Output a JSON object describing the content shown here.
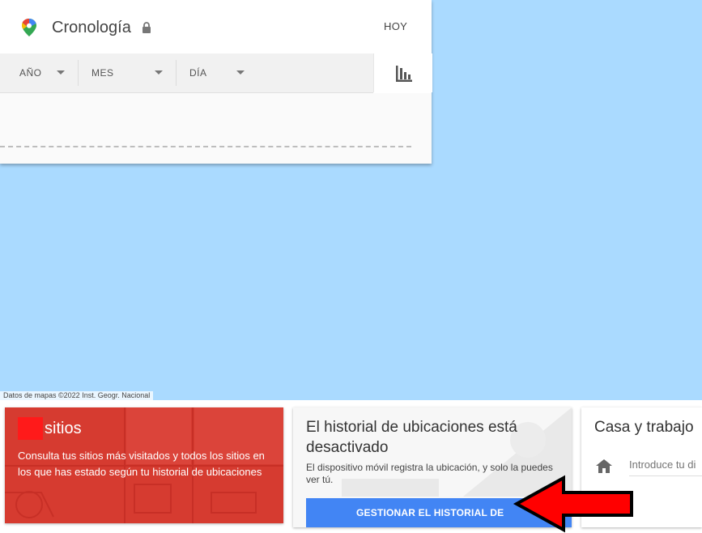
{
  "map": {
    "attribution": "Datos de mapas ©2022 Inst. Geogr. Nacional",
    "water_color": "#aadaff"
  },
  "timeline": {
    "title": "Cronología",
    "today_label": "HOY",
    "icons": {
      "logo": "maps-pin-icon",
      "lock": "lock-icon",
      "chart": "bar-chart-icon"
    },
    "dropdowns": [
      {
        "label": "AÑO"
      },
      {
        "label": "MES"
      },
      {
        "label": "DÍA"
      }
    ]
  },
  "cards": {
    "places": {
      "title": "sitios",
      "description": "Consulta tus sitios más visitados y todos los sitios en los que has estado según tu historial de ubicaciones",
      "color": "#d63b30"
    },
    "history": {
      "title": "El historial de ubicaciones está desactivado",
      "description": "El dispositivo móvil registra la ubicación, y solo la puedes ver tú.",
      "button_label": "GESTIONAR EL HISTORIAL DE",
      "button_color": "#4285f4"
    },
    "home_work": {
      "title": "Casa y trabajo",
      "input_placeholder": "Introduce tu di",
      "icons": {
        "home": "home-icon",
        "work": "work-icon"
      }
    }
  },
  "annotation": {
    "arrow_color": "#ff0000"
  }
}
